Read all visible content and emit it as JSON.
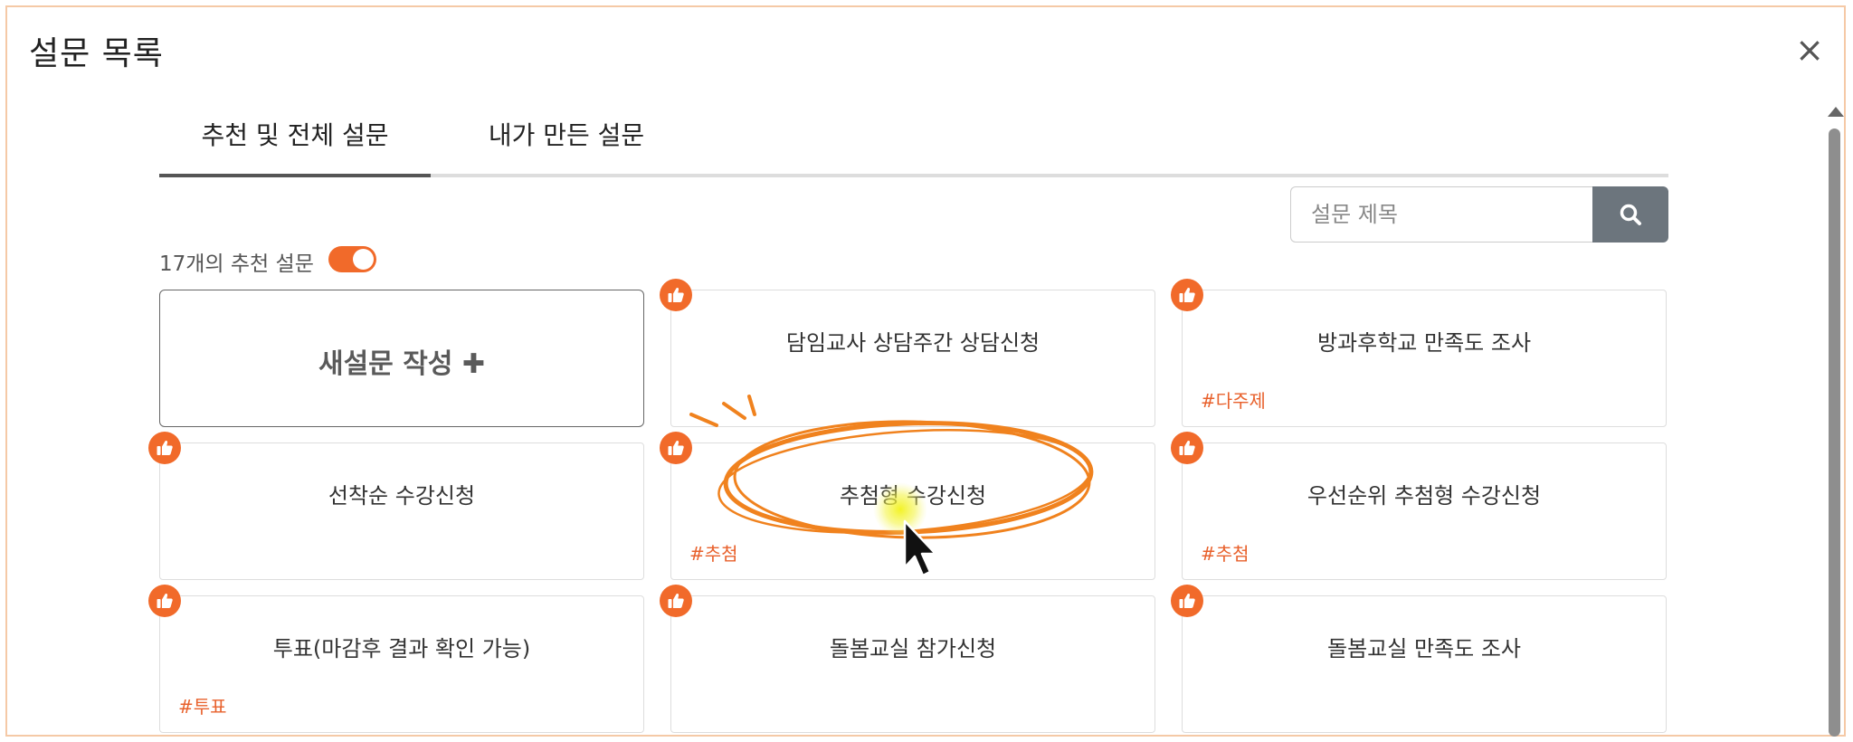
{
  "dialog": {
    "title": "설문 목록",
    "close_label": "×"
  },
  "tabs": [
    {
      "label": "추천 및 전체 설문",
      "active": true
    },
    {
      "label": "내가 만든 설문",
      "active": false
    }
  ],
  "search": {
    "placeholder": "설문 제목",
    "value": "",
    "icon": "search-icon"
  },
  "recommended": {
    "label": "17개의 추천 설문",
    "toggle_on": true
  },
  "new_survey": {
    "label": "새설문 작성 ✚"
  },
  "cards": [
    {
      "title": "담임교사 상담주간 상담신청",
      "tag": ""
    },
    {
      "title": "방과후학교 만족도 조사",
      "tag": "#다주제"
    },
    {
      "title": "선착순 수강신청",
      "tag": ""
    },
    {
      "title": "추첨형 수강신청",
      "tag": "#추첨"
    },
    {
      "title": "우선순위 추첨형 수강신청",
      "tag": "#추첨"
    },
    {
      "title": "투표(마감후 결과 확인 가능)",
      "tag": "#투표"
    },
    {
      "title": "돌봄교실 참가신청",
      "tag": ""
    },
    {
      "title": "돌봄교실 만족도 조사",
      "tag": ""
    }
  ],
  "colors": {
    "accent": "#f16a2a",
    "tag": "#e8612c",
    "search_button": "#6c757d",
    "highlight": "#f0821e"
  }
}
